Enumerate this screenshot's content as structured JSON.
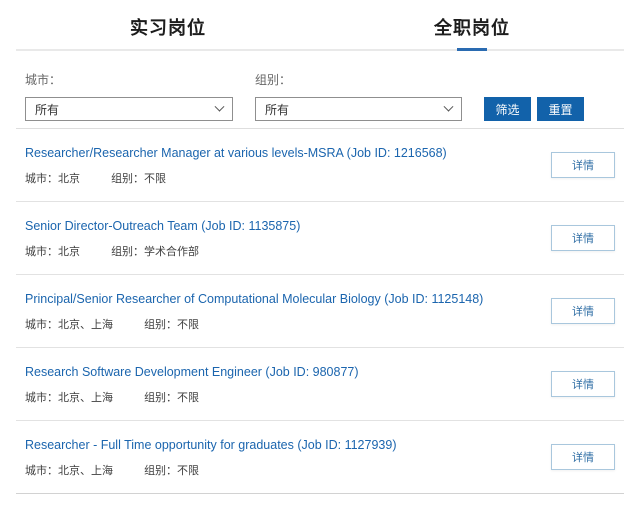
{
  "tabs": {
    "internship_label": "实习岗位",
    "fulltime_label": "全职岗位",
    "active_tab": "全职岗位"
  },
  "filters": {
    "city": {
      "label": "城市：",
      "value": "所有"
    },
    "group": {
      "label": "组别：",
      "value": "所有"
    },
    "filter_button": "筛选",
    "reset_button": "重置"
  },
  "detail_button": "详情",
  "jobs": [
    {
      "title": "Researcher/Researcher Manager at various levels-MSRA (Job ID: 1216568)",
      "city": "城市：北京",
      "group": "组别：不限"
    },
    {
      "title": "Senior Director-Outreach Team (Job ID: 1135875)",
      "city": "城市：北京",
      "group": "组别：学术合作部"
    },
    {
      "title": "Principal/Senior Researcher of Computational Molecular Biology (Job ID: 1125148)",
      "city": "城市：北京、上海",
      "group": "组别：不限"
    },
    {
      "title": "Research Software Development Engineer (Job ID: 980877)",
      "city": "城市：北京、上海",
      "group": "组别：不限"
    },
    {
      "title": "Researcher - Full Time opportunity for graduates (Job ID: 1127939)",
      "city": "城市：北京、上海",
      "group": "组别：不限"
    }
  ],
  "colors": {
    "accent_blue": "#1262aa",
    "link_blue": "#1b65ae",
    "tab_underline": "#2a6bb1",
    "detail_border": "#a9c7dd"
  }
}
